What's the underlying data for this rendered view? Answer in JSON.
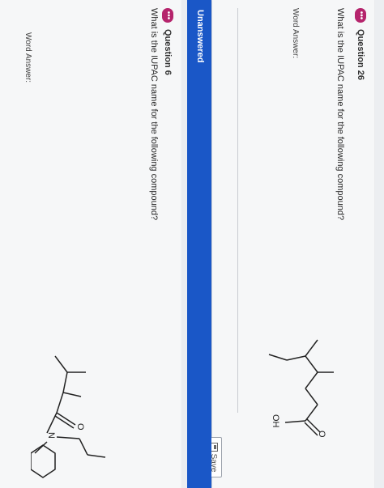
{
  "question26": {
    "icon": "more-dots-icon",
    "dot": "•••",
    "number": "Question 26",
    "prompt": "What is the IUPAC name for the following compound?",
    "answer_label": "Word Answer:",
    "molecule_labels": {
      "carbonyl_o": "O",
      "hydroxyl": "OH"
    }
  },
  "status_bar": {
    "label": "Unanswered"
  },
  "save_button": {
    "label": "Save",
    "icon": "save-icon"
  },
  "question6": {
    "icon": "more-dots-icon",
    "dot": "•••",
    "number": "Question 6",
    "prompt": "What is the IUPAC name for the following compound?",
    "answer_label": "Word Answer:",
    "molecule_labels": {
      "carbonyl_o": "O",
      "nitrogen": "N"
    }
  },
  "colors": {
    "accent_bar": "#1a57c7",
    "question_dot": "#b5246c"
  }
}
